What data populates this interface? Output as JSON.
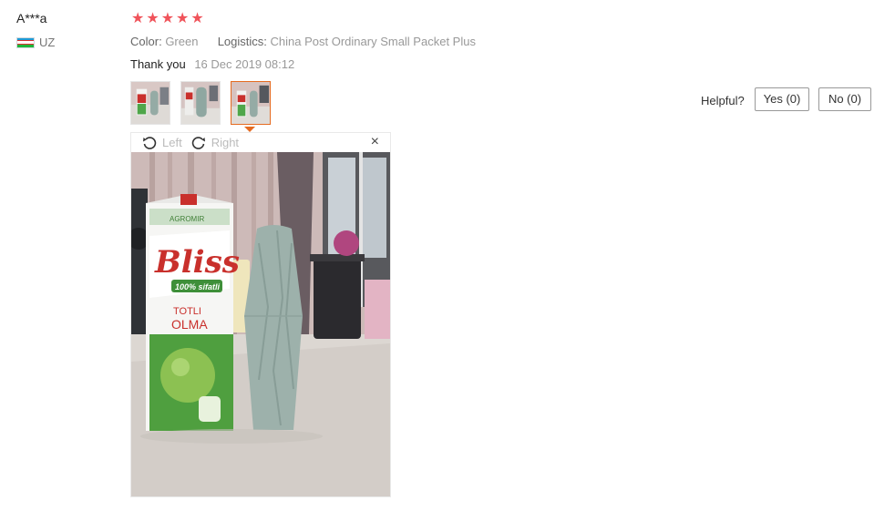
{
  "review": {
    "user_name": "A***a",
    "country": "UZ",
    "rating": 5,
    "color_label": "Color:",
    "color_value": "Green",
    "logistics_label": "Logistics:",
    "logistics_value": "China Post Ordinary Small Packet Plus",
    "feedback_text": "Thank you",
    "date": "16 Dec 2019 08:12"
  },
  "helpful": {
    "label": "Helpful?",
    "yes": "Yes (0)",
    "no": "No (0)"
  },
  "viewer": {
    "rotate_left": "Left",
    "rotate_right": "Right",
    "close": "×"
  },
  "photo": {
    "carton_brand": "Bliss",
    "carton_tagline": "100% sifatli",
    "carton_flavor_1": "TOTLI",
    "carton_flavor_2": "OLMA",
    "carton_top": "AGROMIR"
  },
  "colors": {
    "star": "#f0535a",
    "active_thumb": "#e56b21"
  }
}
